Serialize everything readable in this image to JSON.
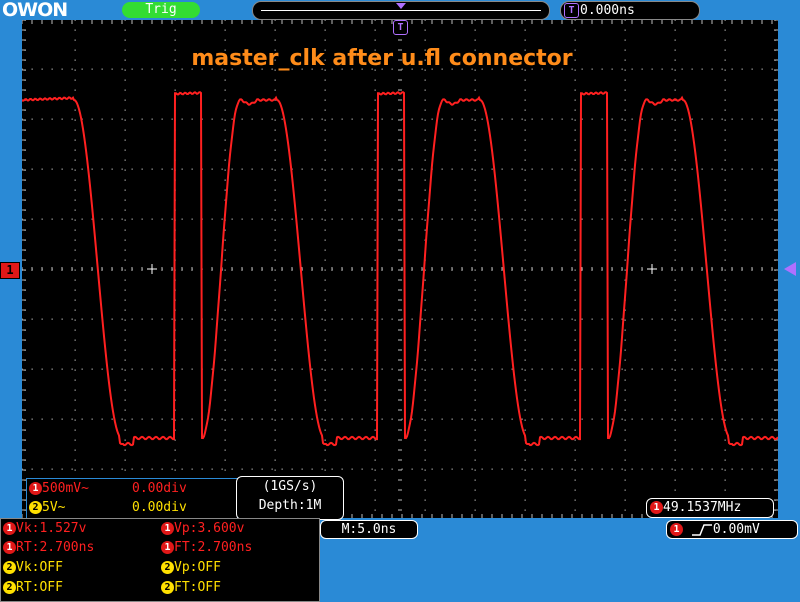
{
  "brand": {
    "logo": "OWON"
  },
  "trigger_status": "Trig",
  "timebase_position": "0.000ns",
  "title_annotation": "master_clk after u.fl connector",
  "channel_marker": "1",
  "marker_icons": {
    "trigger_position": "T"
  },
  "channels": [
    {
      "num": "1",
      "scale": "500mV~",
      "offset": "0.00div",
      "color": "#ff2020"
    },
    {
      "num": "2",
      "scale": "5V~",
      "offset": "0.00div",
      "color": "#ffe000"
    }
  ],
  "acquisition": {
    "rate": "(1GS/s)",
    "depth": "Depth:1M"
  },
  "frequency": {
    "num": "1",
    "value": "49.1537MHz"
  },
  "horizontal": {
    "label": "M:5.0ns"
  },
  "trigger_info": {
    "num": "1",
    "value": "0.00mV"
  },
  "measurements": [
    {
      "num": "1",
      "text": "Vk:1.527v"
    },
    {
      "num": "1",
      "text": "Vp:3.600v"
    },
    {
      "num": "1",
      "text": "RT:2.700ns"
    },
    {
      "num": "1",
      "text": "FT:2.700ns"
    },
    {
      "num": "2",
      "text": "Vk:OFF"
    },
    {
      "num": "2",
      "text": "Vp:OFF"
    },
    {
      "num": "2",
      "text": "RT:OFF"
    },
    {
      "num": "2",
      "text": "FT:OFF"
    }
  ],
  "colors": {
    "ch1": "#ff2020",
    "ch2": "#ffe000",
    "annotation": "#ff8c1a",
    "trigger_marker": "#b070ff",
    "background": "#2a8ad6"
  },
  "waveform": {
    "signal": "master_clk",
    "shape": "square",
    "frequency_mhz": 49.1537,
    "rise_time_ns": 2.7,
    "fall_time_ns": 2.7,
    "high_v": 3.6,
    "low_v": 1.527
  }
}
